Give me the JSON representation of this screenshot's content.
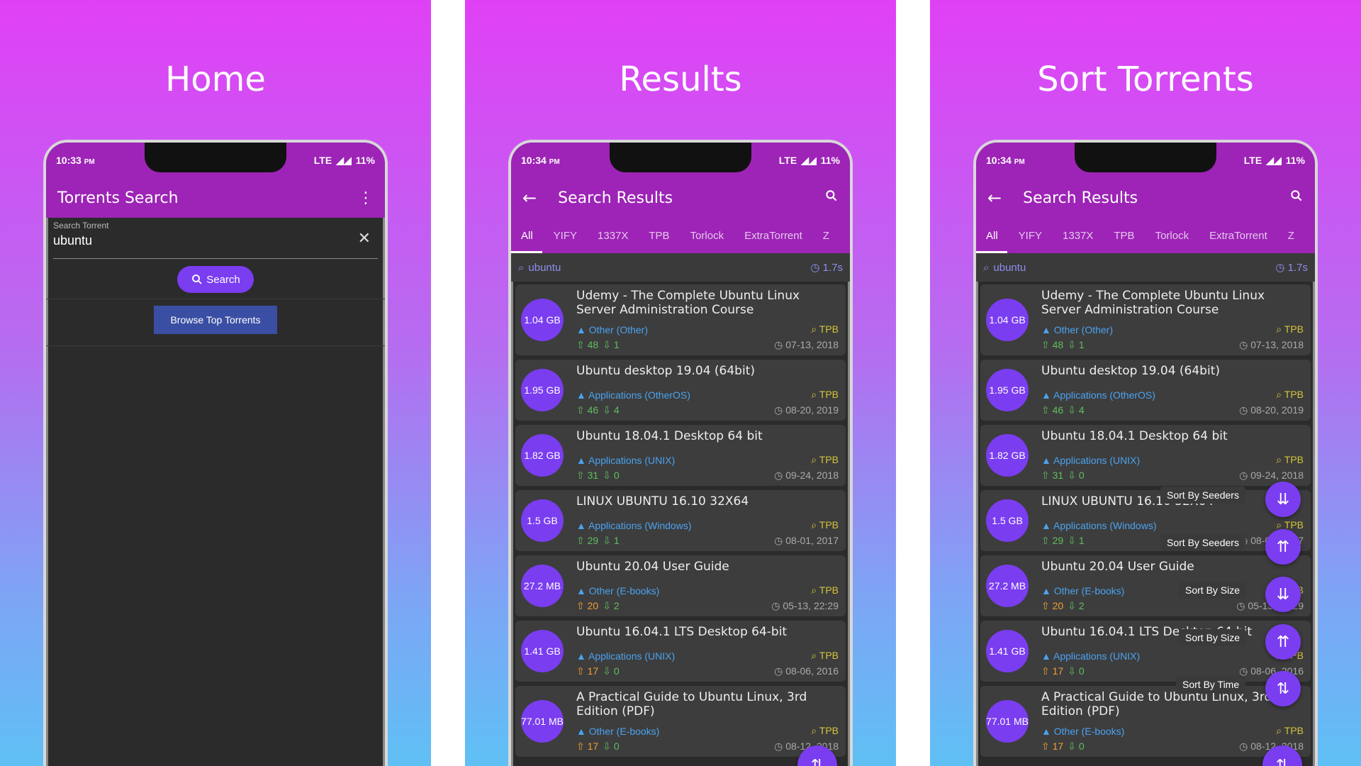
{
  "panels": {
    "home": {
      "title": "Home"
    },
    "results": {
      "title": "Results"
    },
    "sort": {
      "title": "Sort Torrents"
    }
  },
  "status": {
    "home_time": "10:33",
    "other_time": "10:34",
    "ampm": "PM",
    "net": "LTE",
    "battery": "11%"
  },
  "home": {
    "appbar_title": "Torrents Search",
    "field_label": "Search Torrent",
    "field_value": "ubuntu",
    "search_button": "Search",
    "browse_button": "Browse Top Torrents"
  },
  "results": {
    "appbar_title": "Search Results",
    "tabs": [
      "All",
      "YIFY",
      "1337X",
      "TPB",
      "Torlock",
      "ExtraTorrent",
      "Z"
    ],
    "query": "ubuntu",
    "time": "1.7s",
    "items": [
      {
        "size": "1.04 GB",
        "title": "Udemy - The Complete Ubuntu Linux Server Administration Course",
        "category": "Other (Other)",
        "source": "TPB",
        "seeders": "48",
        "leechers": "1",
        "date": "07-13, 2018"
      },
      {
        "size": "1.95 GB",
        "title": "Ubuntu desktop 19.04 (64bit)",
        "category": "Applications (OtherOS)",
        "source": "TPB",
        "seeders": "46",
        "leechers": "4",
        "date": "08-20, 2019"
      },
      {
        "size": "1.82 GB",
        "title": "Ubuntu 18.04.1 Desktop 64 bit",
        "category": "Applications (UNIX)",
        "source": "TPB",
        "seeders": "31",
        "leechers": "0",
        "date": "09-24, 2018"
      },
      {
        "size": "1.5 GB",
        "title": "LINUX UBUNTU 16.10 32X64",
        "category": "Applications (Windows)",
        "source": "TPB",
        "seeders": "29",
        "leechers": "1",
        "date": "08-01, 2017"
      },
      {
        "size": "27.2 MB",
        "title": "Ubuntu 20.04 User Guide",
        "category": "Other (E-books)",
        "source": "TPB",
        "seeders": "20",
        "leechers": "2",
        "date": "05-13, 22:29"
      },
      {
        "size": "1.41 GB",
        "title": "Ubuntu 16.04.1 LTS Desktop 64-bit",
        "category": "Applications (UNIX)",
        "source": "TPB",
        "seeders": "17",
        "leechers": "0",
        "date": "08-06, 2016"
      },
      {
        "size": "77.01 MB",
        "title": "A Practical Guide to Ubuntu Linux, 3rd Edition (PDF)",
        "category": "Other (E-books)",
        "source": "TPB",
        "seeders": "17",
        "leechers": "0",
        "date": "08-12, 2018"
      }
    ]
  },
  "sort_menu": {
    "seeders_asc": "Sort By Seeders",
    "seeders_desc": "Sort By Seeders",
    "size_asc": "Sort By Size",
    "size_desc": "Sort By Size",
    "time": "Sort By Time"
  },
  "icons": {
    "back": "arrow-left-icon",
    "search": "search-icon",
    "more": "more-vert-icon",
    "clear": "close-icon",
    "sort": "sort-icon",
    "clock": "clock-icon",
    "category": "category-icon",
    "source": "magnify-icon",
    "upload": "upload-icon",
    "download": "download-icon"
  },
  "colors": {
    "appbar": "#9d24b6",
    "accent": "#7a3df0",
    "browse": "#3a4fa3",
    "category": "#4aa3f0",
    "seeders": "#5fbf5f",
    "source": "#d3c43a"
  }
}
